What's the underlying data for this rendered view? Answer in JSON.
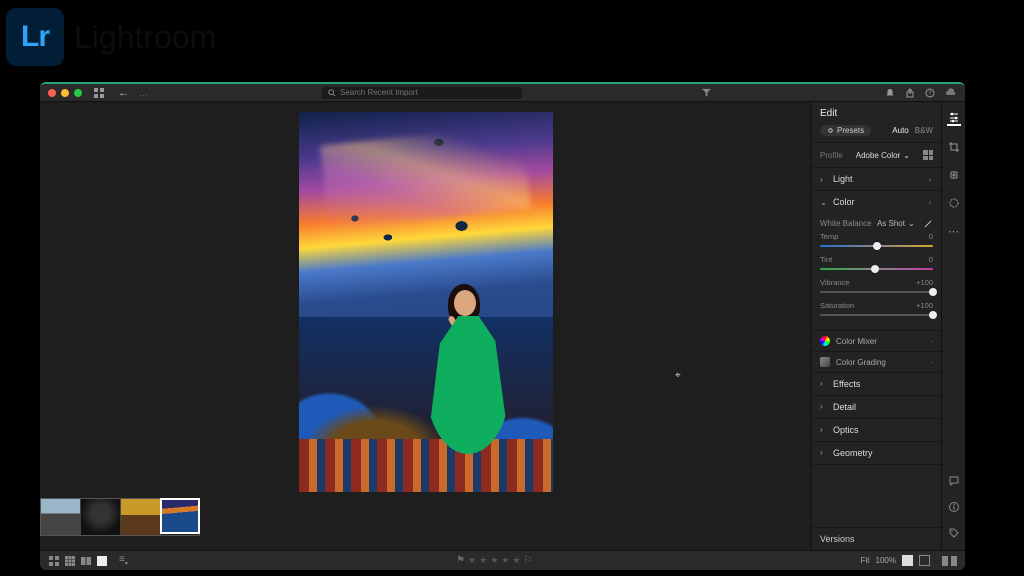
{
  "brand": {
    "logo_text": "Lr",
    "product_name": "Lightroom"
  },
  "titlebar": {
    "breadcrumb": "…",
    "search_placeholder": "Search Recent Import"
  },
  "panel": {
    "title": "Edit",
    "presets_label": "Presets",
    "auto_label": "Auto",
    "bw_label": "B&W",
    "profile_label": "Profile",
    "profile_value": "Adobe Color",
    "sections": {
      "light": {
        "label": "Light"
      },
      "color": {
        "label": "Color",
        "white_balance_label": "White Balance",
        "white_balance_value": "As Shot",
        "temp": {
          "label": "Temp",
          "value": "0",
          "pos": 50
        },
        "tint": {
          "label": "Tint",
          "value": "0",
          "pos": 49
        },
        "vibrance": {
          "label": "Vibrance",
          "value": "+100",
          "pos": 100
        },
        "saturation": {
          "label": "Saturation",
          "value": "+100",
          "pos": 100
        },
        "color_mixer_label": "Color Mixer",
        "color_grading_label": "Color Grading"
      },
      "effects": {
        "label": "Effects"
      },
      "detail": {
        "label": "Detail"
      },
      "optics": {
        "label": "Optics"
      },
      "geometry": {
        "label": "Geometry"
      }
    },
    "versions_label": "Versions"
  },
  "bottombar": {
    "fit_label": "Fit",
    "zoom_value": "100%"
  }
}
